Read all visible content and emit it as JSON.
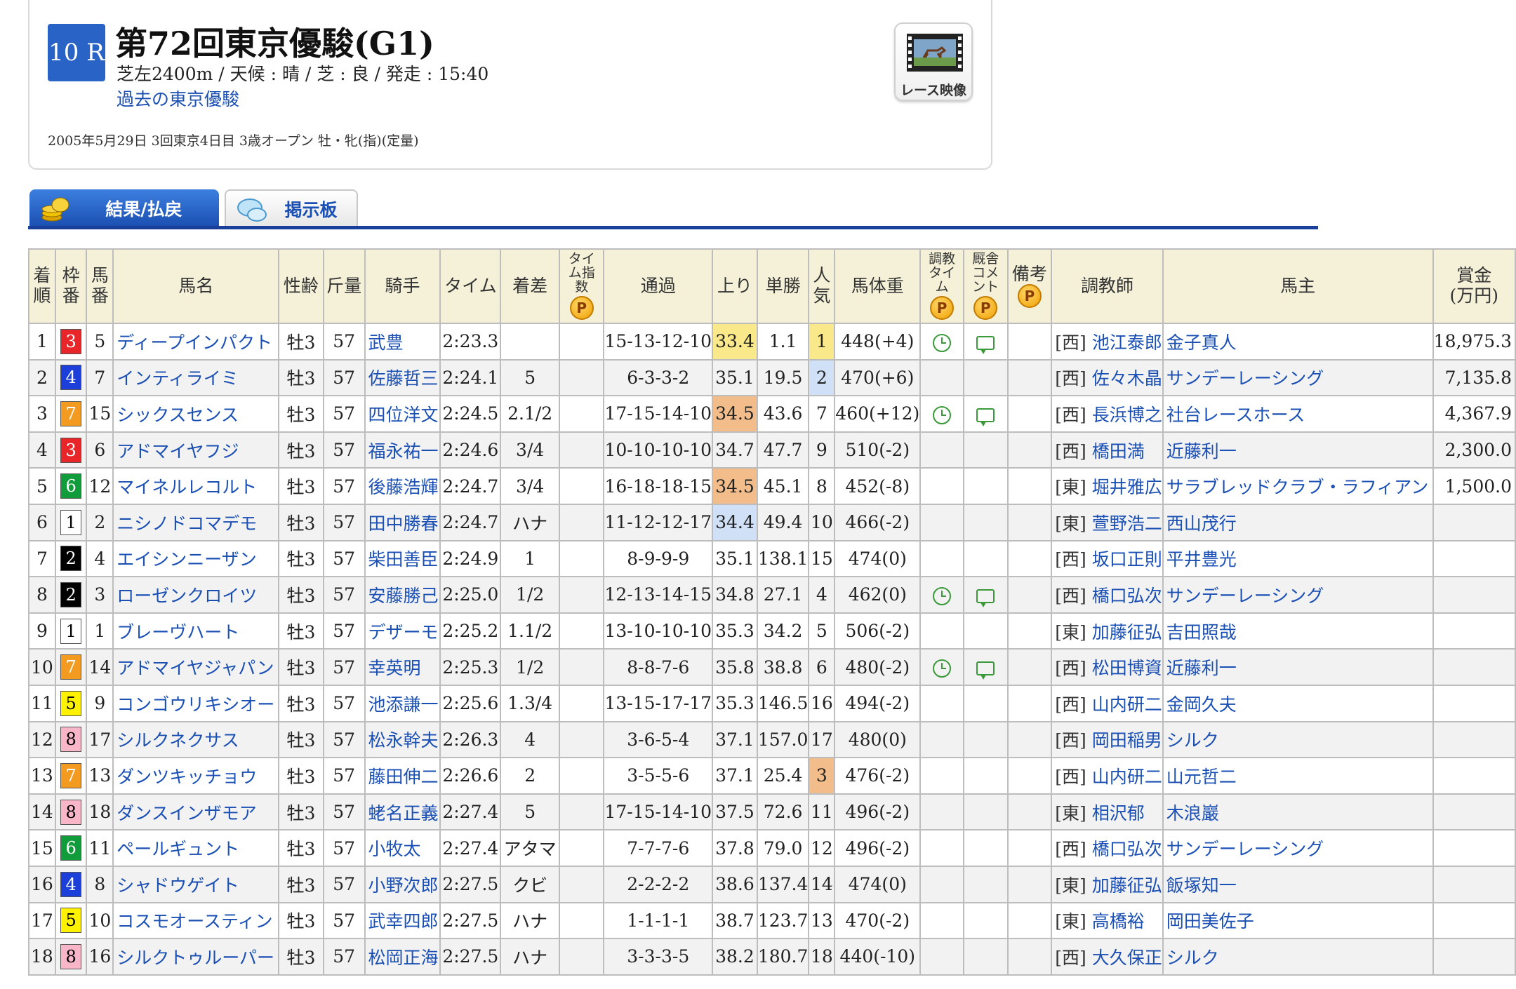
{
  "race": {
    "number": "10 R",
    "title": "第72回東京優駿(G1)",
    "conditions": "芝左2400m / 天候 : 晴 / 芝 : 良 / 発走 : 15:40",
    "past_link": "過去の東京優駿",
    "date_info": "2005年5月29日 3回東京4日目 3歳オープン  牡・牝(指)(定量)",
    "video_label": "レース映像"
  },
  "tabs": [
    {
      "label": "結果/払戻"
    },
    {
      "label": "掲示板"
    }
  ],
  "headers": {
    "finish": "着順",
    "waku": "枠番",
    "umaban": "馬番",
    "name": "馬名",
    "sexage": "性齢",
    "weight": "斤量",
    "jockey": "騎手",
    "time": "タイム",
    "margin": "着差",
    "time_index": "タイム指数",
    "passing": "通過",
    "last3f": "上り",
    "odds": "単勝",
    "popularity": "人気",
    "body_weight": "馬体重",
    "training_time": "調教タイム",
    "stable_comment": "厩舎コメント",
    "remarks": "備考",
    "trainer": "調教師",
    "owner": "馬主",
    "prize": "賞金(万円)"
  },
  "badges": {
    "premium": "P"
  },
  "colors": {
    "waku": {
      "1": "#ffffff",
      "2": "#000000",
      "3": "#e8262a",
      "4": "#1b3fd8",
      "5": "#fff200",
      "6": "#119c3b",
      "7": "#f39a21",
      "8": "#f8b6c8"
    },
    "link": "#1a4fb4",
    "header_bg": "#f4f1d8"
  },
  "rows": [
    {
      "finish": "1",
      "waku": "3",
      "umaban": "5",
      "name": "ディープインパクト",
      "sexage": "牡3",
      "weight": "57",
      "jockey": "武豊",
      "time": "2:23.3",
      "margin": "",
      "passing": "15-13-12-10",
      "last3f": "33.4",
      "odds": "1.1",
      "popularity": "1",
      "body_weight": "448(+4)",
      "train": true,
      "comment": true,
      "region": "[西]",
      "trainer": "池江泰郎",
      "owner": "金子真人",
      "prize": "18,975.3",
      "hl_last3f": "y",
      "hl_pop": "y"
    },
    {
      "finish": "2",
      "waku": "4",
      "umaban": "7",
      "name": "インティライミ",
      "sexage": "牡3",
      "weight": "57",
      "jockey": "佐藤哲三",
      "time": "2:24.1",
      "margin": "5",
      "passing": "6-3-3-2",
      "last3f": "35.1",
      "odds": "19.5",
      "popularity": "2",
      "body_weight": "470(+6)",
      "train": false,
      "comment": false,
      "region": "[西]",
      "trainer": "佐々木晶",
      "owner": "サンデーレーシング",
      "prize": "7,135.8",
      "hl_last3f": "",
      "hl_pop": "b"
    },
    {
      "finish": "3",
      "waku": "7",
      "umaban": "15",
      "name": "シックスセンス",
      "sexage": "牡3",
      "weight": "57",
      "jockey": "四位洋文",
      "time": "2:24.5",
      "margin": "2.1/2",
      "passing": "17-15-14-10",
      "last3f": "34.5",
      "odds": "43.6",
      "popularity": "7",
      "body_weight": "460(+12)",
      "train": true,
      "comment": true,
      "region": "[西]",
      "trainer": "長浜博之",
      "owner": "社台レースホース",
      "prize": "4,367.9",
      "hl_last3f": "o",
      "hl_pop": ""
    },
    {
      "finish": "4",
      "waku": "3",
      "umaban": "6",
      "name": "アドマイヤフジ",
      "sexage": "牡3",
      "weight": "57",
      "jockey": "福永祐一",
      "time": "2:24.6",
      "margin": "3/4",
      "passing": "10-10-10-10",
      "last3f": "34.7",
      "odds": "47.7",
      "popularity": "9",
      "body_weight": "510(-2)",
      "train": false,
      "comment": false,
      "region": "[西]",
      "trainer": "橋田満",
      "owner": "近藤利一",
      "prize": "2,300.0",
      "hl_last3f": "",
      "hl_pop": ""
    },
    {
      "finish": "5",
      "waku": "6",
      "umaban": "12",
      "name": "マイネルレコルト",
      "sexage": "牡3",
      "weight": "57",
      "jockey": "後藤浩輝",
      "time": "2:24.7",
      "margin": "3/4",
      "passing": "16-18-18-15",
      "last3f": "34.5",
      "odds": "45.1",
      "popularity": "8",
      "body_weight": "452(-8)",
      "train": false,
      "comment": false,
      "region": "[東]",
      "trainer": "堀井雅広",
      "owner": "サラブレッドクラブ・ラフィアン",
      "prize": "1,500.0",
      "hl_last3f": "o",
      "hl_pop": ""
    },
    {
      "finish": "6",
      "waku": "1",
      "umaban": "2",
      "name": "ニシノドコマデモ",
      "sexage": "牡3",
      "weight": "57",
      "jockey": "田中勝春",
      "time": "2:24.7",
      "margin": "ハナ",
      "passing": "11-12-12-17",
      "last3f": "34.4",
      "odds": "49.4",
      "popularity": "10",
      "body_weight": "466(-2)",
      "train": false,
      "comment": false,
      "region": "[東]",
      "trainer": "萱野浩二",
      "owner": "西山茂行",
      "prize": "",
      "hl_last3f": "b",
      "hl_pop": ""
    },
    {
      "finish": "7",
      "waku": "2",
      "umaban": "4",
      "name": "エイシンニーザン",
      "sexage": "牡3",
      "weight": "57",
      "jockey": "柴田善臣",
      "time": "2:24.9",
      "margin": "1",
      "passing": "8-9-9-9",
      "last3f": "35.1",
      "odds": "138.1",
      "popularity": "15",
      "body_weight": "474(0)",
      "train": false,
      "comment": false,
      "region": "[西]",
      "trainer": "坂口正則",
      "owner": "平井豊光",
      "prize": "",
      "hl_last3f": "",
      "hl_pop": ""
    },
    {
      "finish": "8",
      "waku": "2",
      "umaban": "3",
      "name": "ローゼンクロイツ",
      "sexage": "牡3",
      "weight": "57",
      "jockey": "安藤勝己",
      "time": "2:25.0",
      "margin": "1/2",
      "passing": "12-13-14-15",
      "last3f": "34.8",
      "odds": "27.1",
      "popularity": "4",
      "body_weight": "462(0)",
      "train": true,
      "comment": true,
      "region": "[西]",
      "trainer": "橋口弘次",
      "owner": "サンデーレーシング",
      "prize": "",
      "hl_last3f": "",
      "hl_pop": ""
    },
    {
      "finish": "9",
      "waku": "1",
      "umaban": "1",
      "name": "ブレーヴハート",
      "sexage": "牡3",
      "weight": "57",
      "jockey": "デザーモ",
      "time": "2:25.2",
      "margin": "1.1/2",
      "passing": "13-10-10-10",
      "last3f": "35.3",
      "odds": "34.2",
      "popularity": "5",
      "body_weight": "506(-2)",
      "train": false,
      "comment": false,
      "region": "[東]",
      "trainer": "加藤征弘",
      "owner": "吉田照哉",
      "prize": "",
      "hl_last3f": "",
      "hl_pop": ""
    },
    {
      "finish": "10",
      "waku": "7",
      "umaban": "14",
      "name": "アドマイヤジャパン",
      "sexage": "牡3",
      "weight": "57",
      "jockey": "幸英明",
      "time": "2:25.3",
      "margin": "1/2",
      "passing": "8-8-7-6",
      "last3f": "35.8",
      "odds": "38.8",
      "popularity": "6",
      "body_weight": "480(-2)",
      "train": true,
      "comment": true,
      "region": "[西]",
      "trainer": "松田博資",
      "owner": "近藤利一",
      "prize": "",
      "hl_last3f": "",
      "hl_pop": ""
    },
    {
      "finish": "11",
      "waku": "5",
      "umaban": "9",
      "name": "コンゴウリキシオー",
      "sexage": "牡3",
      "weight": "57",
      "jockey": "池添謙一",
      "time": "2:25.6",
      "margin": "1.3/4",
      "passing": "13-15-17-17",
      "last3f": "35.3",
      "odds": "146.5",
      "popularity": "16",
      "body_weight": "494(-2)",
      "train": false,
      "comment": false,
      "region": "[西]",
      "trainer": "山内研二",
      "owner": "金岡久夫",
      "prize": "",
      "hl_last3f": "",
      "hl_pop": ""
    },
    {
      "finish": "12",
      "waku": "8",
      "umaban": "17",
      "name": "シルクネクサス",
      "sexage": "牡3",
      "weight": "57",
      "jockey": "松永幹夫",
      "time": "2:26.3",
      "margin": "4",
      "passing": "3-6-5-4",
      "last3f": "37.1",
      "odds": "157.0",
      "popularity": "17",
      "body_weight": "480(0)",
      "train": false,
      "comment": false,
      "region": "[西]",
      "trainer": "岡田稲男",
      "owner": "シルク",
      "prize": "",
      "hl_last3f": "",
      "hl_pop": ""
    },
    {
      "finish": "13",
      "waku": "7",
      "umaban": "13",
      "name": "ダンツキッチョウ",
      "sexage": "牡3",
      "weight": "57",
      "jockey": "藤田伸二",
      "time": "2:26.6",
      "margin": "2",
      "passing": "3-5-5-6",
      "last3f": "37.1",
      "odds": "25.4",
      "popularity": "3",
      "body_weight": "476(-2)",
      "train": false,
      "comment": false,
      "region": "[西]",
      "trainer": "山内研二",
      "owner": "山元哲二",
      "prize": "",
      "hl_last3f": "",
      "hl_pop": "o"
    },
    {
      "finish": "14",
      "waku": "8",
      "umaban": "18",
      "name": "ダンスインザモア",
      "sexage": "牡3",
      "weight": "57",
      "jockey": "蛯名正義",
      "time": "2:27.4",
      "margin": "5",
      "passing": "17-15-14-10",
      "last3f": "37.5",
      "odds": "72.6",
      "popularity": "11",
      "body_weight": "496(-2)",
      "train": false,
      "comment": false,
      "region": "[東]",
      "trainer": "相沢郁",
      "owner": "木浪巖",
      "prize": "",
      "hl_last3f": "",
      "hl_pop": ""
    },
    {
      "finish": "15",
      "waku": "6",
      "umaban": "11",
      "name": "ペールギュント",
      "sexage": "牡3",
      "weight": "57",
      "jockey": "小牧太",
      "time": "2:27.4",
      "margin": "アタマ",
      "passing": "7-7-7-6",
      "last3f": "37.8",
      "odds": "79.0",
      "popularity": "12",
      "body_weight": "496(-2)",
      "train": false,
      "comment": false,
      "region": "[西]",
      "trainer": "橋口弘次",
      "owner": "サンデーレーシング",
      "prize": "",
      "hl_last3f": "",
      "hl_pop": ""
    },
    {
      "finish": "16",
      "waku": "4",
      "umaban": "8",
      "name": "シャドウゲイト",
      "sexage": "牡3",
      "weight": "57",
      "jockey": "小野次郎",
      "time": "2:27.5",
      "margin": "クビ",
      "passing": "2-2-2-2",
      "last3f": "38.6",
      "odds": "137.4",
      "popularity": "14",
      "body_weight": "474(0)",
      "train": false,
      "comment": false,
      "region": "[東]",
      "trainer": "加藤征弘",
      "owner": "飯塚知一",
      "prize": "",
      "hl_last3f": "",
      "hl_pop": ""
    },
    {
      "finish": "17",
      "waku": "5",
      "umaban": "10",
      "name": "コスモオースティン",
      "sexage": "牡3",
      "weight": "57",
      "jockey": "武幸四郎",
      "time": "2:27.5",
      "margin": "ハナ",
      "passing": "1-1-1-1",
      "last3f": "38.7",
      "odds": "123.7",
      "popularity": "13",
      "body_weight": "470(-2)",
      "train": false,
      "comment": false,
      "region": "[東]",
      "trainer": "高橋裕",
      "owner": "岡田美佐子",
      "prize": "",
      "hl_last3f": "",
      "hl_pop": ""
    },
    {
      "finish": "18",
      "waku": "8",
      "umaban": "16",
      "name": "シルクトゥルーパー",
      "sexage": "牡3",
      "weight": "57",
      "jockey": "松岡正海",
      "time": "2:27.5",
      "margin": "ハナ",
      "passing": "3-3-3-5",
      "last3f": "38.2",
      "odds": "180.7",
      "popularity": "18",
      "body_weight": "440(-10)",
      "train": false,
      "comment": false,
      "region": "[西]",
      "trainer": "大久保正",
      "owner": "シルク",
      "prize": "",
      "hl_last3f": "",
      "hl_pop": ""
    }
  ]
}
